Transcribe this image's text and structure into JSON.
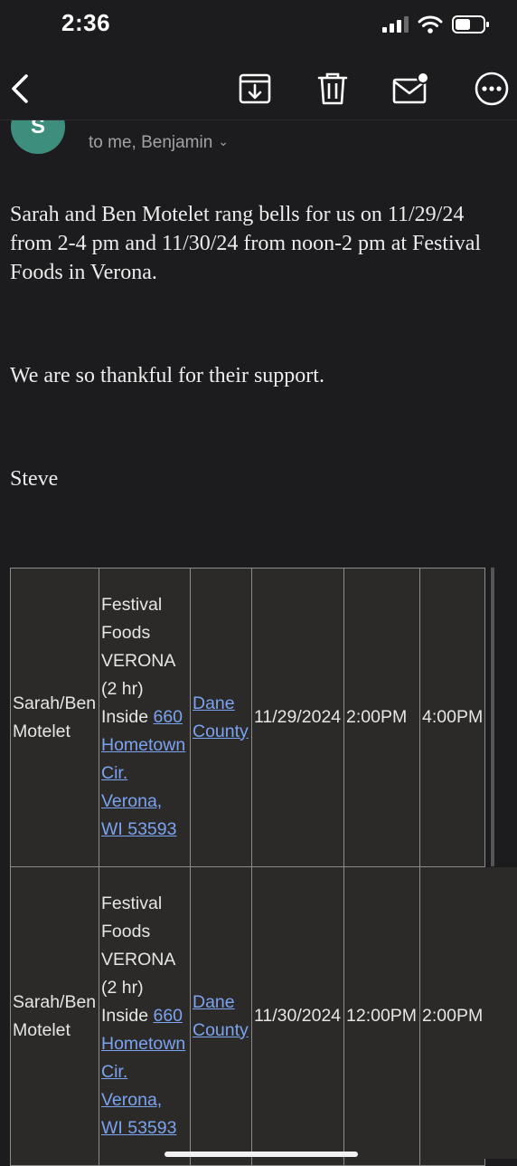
{
  "status": {
    "time": "2:36"
  },
  "toolbar": {
    "icons": [
      "back-icon",
      "archive-icon",
      "trash-icon",
      "unread-mail-icon",
      "more-icon"
    ]
  },
  "sender": {
    "avatar_letter": "S",
    "recipients": "to me, Benjamin"
  },
  "message": {
    "paragraph1": "Sarah and Ben Motelet rang bells for us on 11/29/24 from 2-4 pm and 11/30/24 from noon-2 pm at Festival Foods in Verona.",
    "paragraph2": "We are so thankful for their support.",
    "signature": "Steve"
  },
  "table": {
    "rows": [
      {
        "name": "Sarah/Ben Motelet",
        "location": "Festival Foods VERONA (2 hr) Inside",
        "address": "660 Hometown Cir. Verona, WI 53593",
        "county": "Dane County",
        "date": "11/29/2024",
        "start": "2:00PM",
        "end": "4:00PM"
      },
      {
        "name": "Sarah/Ben Motelet",
        "location": "Festival Foods VERONA (2 hr) Inside",
        "address": "660 Hometown Cir. Verona, WI 53593",
        "county": "Dane County",
        "date": "11/30/2024",
        "start": "12:00PM",
        "end": "2:00PM"
      }
    ]
  }
}
